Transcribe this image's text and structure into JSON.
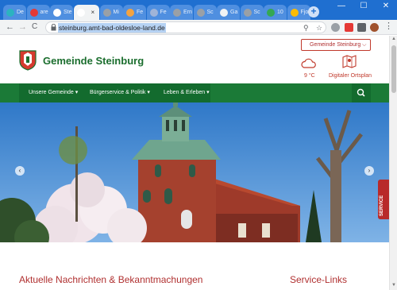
{
  "browser": {
    "tabs": [
      {
        "label": "De",
        "color": "#2bb3c0"
      },
      {
        "label": "are",
        "color": "#e53935"
      },
      {
        "label": "Ste",
        "color": "#ffffff"
      },
      {
        "label": "",
        "color": "#ffffff",
        "active": true,
        "close": "×"
      },
      {
        "label": "Mi",
        "color": "#9aa0a6"
      },
      {
        "label": "Fe",
        "color": "#f4a340"
      },
      {
        "label": "Fe",
        "color": "#9fb4d8"
      },
      {
        "label": "Ern",
        "color": "#9aa0a6"
      },
      {
        "label": "Sc",
        "color": "#9aa0a6"
      },
      {
        "label": "Ga",
        "color": "#f1f3f4"
      },
      {
        "label": "Sc",
        "color": "#9aa0a6"
      },
      {
        "label": "10",
        "color": "#34a853"
      },
      {
        "label": "Fjo",
        "color": "#fbbc04"
      }
    ],
    "new_tab": "+",
    "window": {
      "minimize": "—",
      "maximize": "☐",
      "close": "✕"
    },
    "nav": {
      "back": "←",
      "forward": "→",
      "reload": "C"
    },
    "url": "steinburg.amt-bad-oldesloe-land.de",
    "omni_icons": {
      "search": "⚲",
      "star": "☆"
    }
  },
  "header": {
    "site_name": "Gemeinde Steinburg",
    "gemeinde_select": "Gemeinde Steinburg",
    "weather": "9 °C",
    "map_label": "Digitaler Ortsplan",
    "accent": "#c0392b",
    "brand": "#1b6e2e"
  },
  "mainnav": {
    "items": [
      "Unsere Gemeinde ▾",
      "Bürgerservice & Politik ▾",
      "Leben & Erleben ▾"
    ],
    "search_icon": "search-icon"
  },
  "hero": {
    "prev": "‹",
    "next": "›",
    "service_tab": "SERVICE"
  },
  "sections": {
    "news_title": "Aktuelle Nachrichten & Bekanntmachungen",
    "links_title": "Service-Links"
  }
}
